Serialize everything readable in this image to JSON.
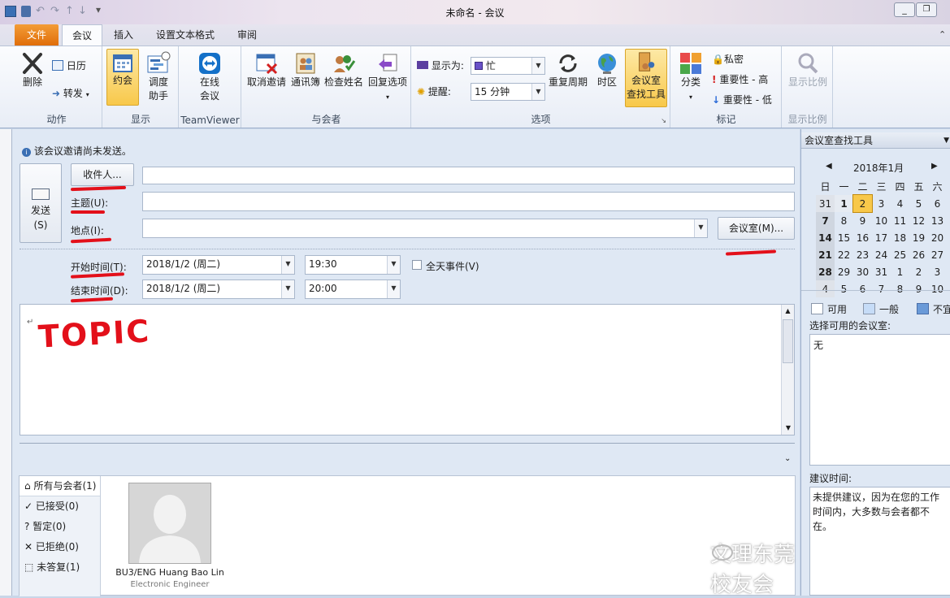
{
  "window": {
    "title": "未命名 - 会议"
  },
  "tabs": {
    "file": "文件",
    "meeting": "会议",
    "insert": "插入",
    "format": "设置文本格式",
    "review": "审阅"
  },
  "ribbon": {
    "delete": "删除",
    "calendar": "日历",
    "forward": "转发",
    "group_actions": "动作",
    "appointment": "约会",
    "scheduling1": "调度",
    "scheduling2": "助手",
    "group_show": "显示",
    "online1": "在线",
    "online2": "会议",
    "group_teamviewer": "TeamViewer",
    "cancel_invite": "取消邀请",
    "address_book": "通讯簿",
    "check_names": "检查姓名",
    "response_options": "回复选项",
    "group_attendees": "与会者",
    "show_as_label": "显示为:",
    "show_as_value": "忙",
    "reminder_label": "提醒:",
    "reminder_value": "15 分钟",
    "recurrence": "重复周期",
    "timezones": "时区",
    "room_finder1": "会议室",
    "room_finder2": "查找工具",
    "group_options": "选项",
    "categorize": "分类",
    "private": "私密",
    "high_importance": "重要性 - 高",
    "low_importance": "重要性 - 低",
    "group_tags": "标记",
    "zoom": "显示比例",
    "group_zoom": "显示比例"
  },
  "form": {
    "info": "该会议邀请尚未发送。",
    "send1": "发送",
    "send2": "(S)",
    "to_button": "收件人...",
    "subject_label": "主题(U):",
    "location_label": "地点(I):",
    "rooms_button": "会议室(M)...",
    "start_label": "开始时间(T):",
    "start_date": "2018/1/2 (周二)",
    "start_time": "19:30",
    "allday": "全天事件(V)",
    "end_label": "结束时间(D):",
    "end_date": "2018/1/2 (周二)",
    "end_time": "20:00",
    "body_text": "TOPIC"
  },
  "attendees": {
    "all": "所有与会者(1)",
    "accepted": "已接受(0)",
    "tentative": "暂定(0)",
    "declined": "已拒绝(0)",
    "noresponse": "未答复(1)",
    "person_name": "BU3/ENG Huang Bao Lin",
    "person_title": "Electronic Engineer"
  },
  "roomfinder": {
    "title": "会议室查找工具",
    "month": "2018年1月",
    "weekdays": [
      "日",
      "一",
      "二",
      "三",
      "四",
      "五",
      "六"
    ],
    "weeks": [
      [
        "31",
        "1",
        "2",
        "3",
        "4",
        "5",
        "6"
      ],
      [
        "7",
        "8",
        "9",
        "10",
        "11",
        "12",
        "13"
      ],
      [
        "14",
        "15",
        "16",
        "17",
        "18",
        "19",
        "20"
      ],
      [
        "21",
        "22",
        "23",
        "24",
        "25",
        "26",
        "27"
      ],
      [
        "28",
        "29",
        "30",
        "31",
        "1",
        "2",
        "3"
      ],
      [
        "4",
        "5",
        "6",
        "7",
        "8",
        "9",
        "10"
      ]
    ],
    "legend_free": "可用",
    "legend_fair": "一般",
    "legend_poor": "不宜",
    "rooms_label": "选择可用的会议室:",
    "rooms_value": "无",
    "suggest_label": "建议时间:",
    "suggest_text": "未提供建议，因为在您的工作时间内，大多数与会者都不在。"
  },
  "watermark": "文理东莞校友会"
}
